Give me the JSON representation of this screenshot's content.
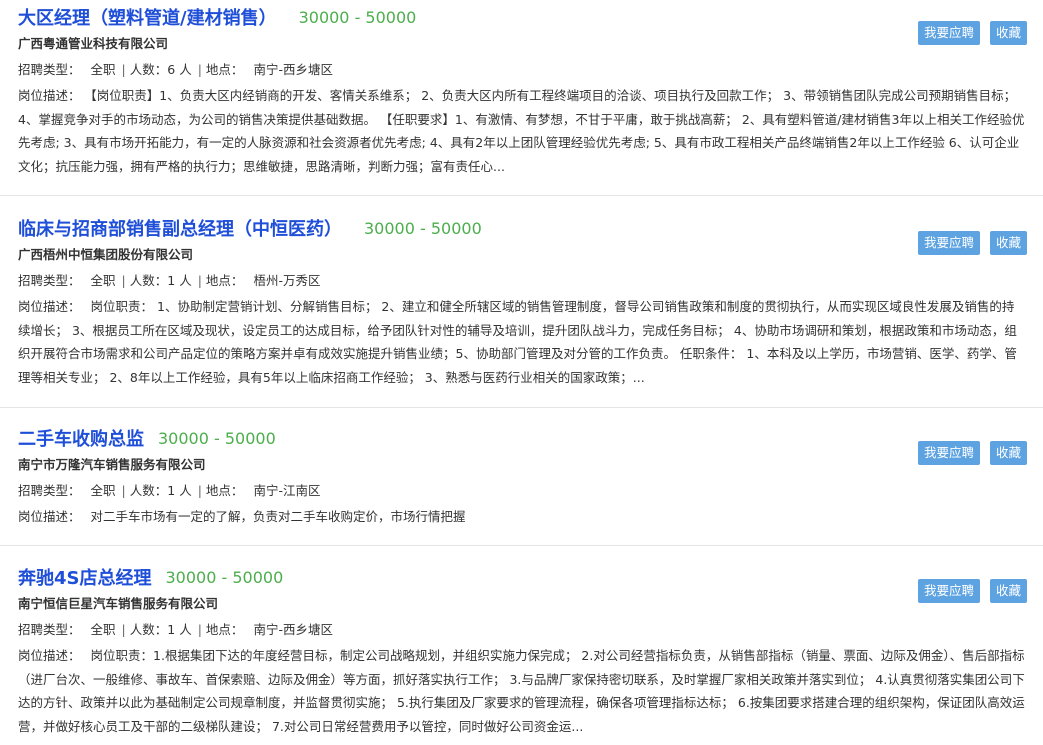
{
  "jobs": [
    {
      "title": "大区经理（塑料管道/建材销售）",
      "salary": "30000 - 50000",
      "company": "广西粤通管业科技有限公司",
      "type_label": "招聘类型：",
      "type_value": "全职",
      "count_label": "人数：",
      "count_value": "6 人",
      "location_label": "地点：",
      "location_value": "南宁-西乡塘区",
      "desc_label": "岗位描述：",
      "desc": "【岗位职责】1、负责大区内经销商的开发、客情关系维系； 2、负责大区内所有工程终端项目的洽谈、项目执行及回款工作； 3、带领销售团队完成公司预期销售目标； 4、掌握竞争对手的市场动态，为公司的销售决策提供基础数据。 【任职要求】1、有激情、有梦想，不甘于平庸，敢于挑战高薪； 2、具有塑料管道/建材销售3年以上相关工作经验优先考虑; 3、具有市场开拓能力，有一定的人脉资源和社会资源者优先考虑; 4、具有2年以上团队管理经验优先考虑; 5、具有市政工程相关产品终端销售2年以上工作经验 6、认可企业文化；抗压能力强，拥有严格的执行力；思维敏捷，思路清晰，判断力强；富有责任心...",
      "apply_label": "我要应聘",
      "save_label": "收藏"
    },
    {
      "title": "临床与招商部销售副总经理（中恒医药）",
      "salary": "30000 - 50000",
      "company": "广西梧州中恒集团股份有限公司",
      "type_label": "招聘类型：",
      "type_value": "全职",
      "count_label": "人数：",
      "count_value": "1 人",
      "location_label": "地点：",
      "location_value": "梧州-万秀区",
      "desc_label": "岗位描述：",
      "desc": "岗位职责： 1、协助制定营销计划、分解销售目标； 2、建立和健全所辖区域的销售管理制度，督导公司销售政策和制度的贯彻执行，从而实现区域良性发展及销售的持续增长； 3、根据员工所在区域及现状，设定员工的达成目标，给予团队针对性的辅导及培训，提升团队战斗力，完成任务目标； 4、协助市场调研和策划，根据政策和市场动态，组织开展符合市场需求和公司产品定位的策略方案并卓有成效实施提升销售业绩；5、协助部门管理及对分管的工作负责。 任职条件： 1、本科及以上学历，市场营销、医学、药学、管理等相关专业； 2、8年以上工作经验，具有5年以上临床招商工作经验； 3、熟悉与医药行业相关的国家政策；...",
      "apply_label": "我要应聘",
      "save_label": "收藏"
    },
    {
      "title": "二手车收购总监",
      "salary": "30000 - 50000",
      "company": "南宁市万隆汽车销售服务有限公司",
      "type_label": "招聘类型：",
      "type_value": "全职",
      "count_label": "人数：",
      "count_value": "1 人",
      "location_label": "地点：",
      "location_value": "南宁-江南区",
      "desc_label": "岗位描述：",
      "desc": "对二手车市场有一定的了解，负责对二手车收购定价，市场行情把握",
      "apply_label": "我要应聘",
      "save_label": "收藏"
    },
    {
      "title": "奔驰4S店总经理",
      "salary": "30000 - 50000",
      "company": "南宁恒信巨星汽车销售服务有限公司",
      "type_label": "招聘类型：",
      "type_value": "全职",
      "count_label": "人数：",
      "count_value": "1 人",
      "location_label": "地点：",
      "location_value": "南宁-西乡塘区",
      "desc_label": "岗位描述：",
      "desc": "岗位职责：1.根据集团下达的年度经营目标，制定公司战略规划，并组织实施力保完成； 2.对公司经营指标负责，从销售部指标（销量、票面、边际及佣金）、售后部指标（进厂台次、一般维修、事故车、首保索赔、边际及佣金）等方面，抓好落实执行工作； 3.与品牌厂家保持密切联系，及时掌握厂家相关政策并落实到位； 4.认真贯彻落实集团公司下达的方针、政策并以此为基础制定公司规章制度，并监督贯彻实施； 5.执行集团及厂家要求的管理流程，确保各项管理指标达标； 6.按集团要求搭建合理的组织架构，保证团队高效运营，并做好核心员工及干部的二级梯队建设； 7.对公司日常经营费用予以管控，同时做好公司资金运...",
      "apply_label": "我要应聘",
      "save_label": "收藏"
    }
  ]
}
